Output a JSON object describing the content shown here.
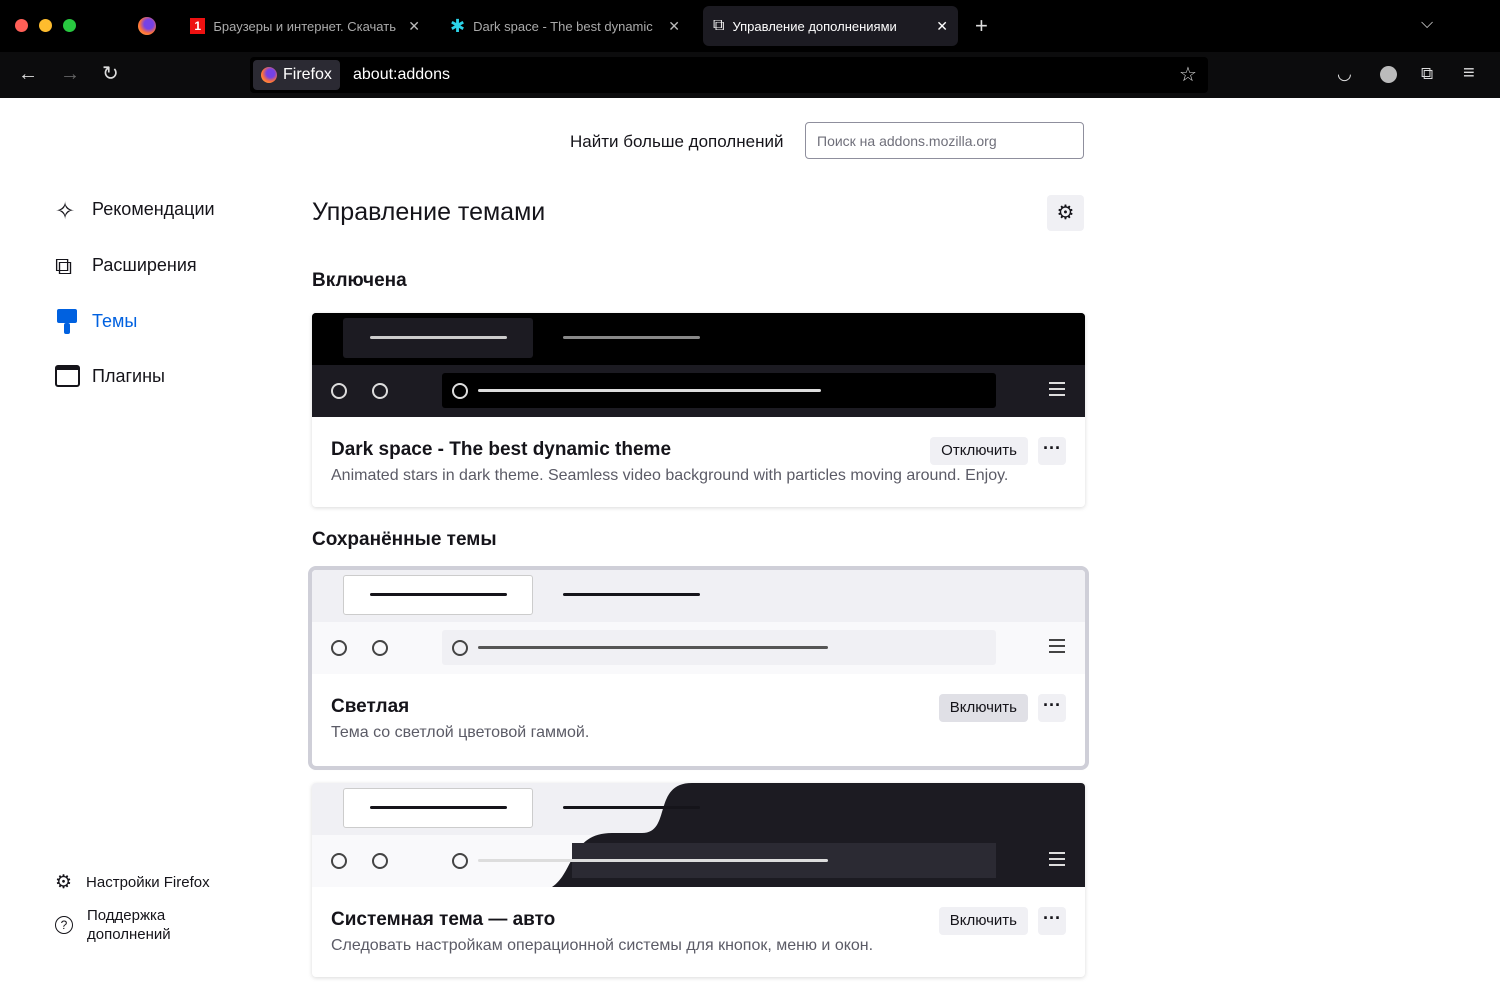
{
  "browser": {
    "tabs": [
      {
        "title": "Браузеры и интернет. Скачать",
        "icon": "softportal-icon"
      },
      {
        "title": "Dark space - The best dynamic",
        "icon": "dark-space-icon"
      },
      {
        "title": "Управление дополнениями",
        "icon": "puzzle-icon",
        "active": true
      }
    ],
    "identity": "Firefox",
    "url": "about:addons"
  },
  "header": {
    "find_more": "Найти больше дополнений",
    "search_placeholder": "Поиск на addons.mozilla.org"
  },
  "sidebar": {
    "items": [
      {
        "label": "Рекомендации",
        "icon": "sparkle-icon"
      },
      {
        "label": "Расширения",
        "icon": "puzzle-icon"
      },
      {
        "label": "Темы",
        "icon": "brush-icon",
        "selected": true
      },
      {
        "label": "Плагины",
        "icon": "plugin-icon"
      }
    ],
    "footer": [
      {
        "label": "Настройки Firefox",
        "icon": "gear-icon"
      },
      {
        "label": "Поддержка дополнений",
        "icon": "help-icon"
      }
    ]
  },
  "main": {
    "title": "Управление темами",
    "enabled_heading": "Включена",
    "saved_heading": "Сохранённые темы",
    "themes": [
      {
        "name": "Dark space - The best dynamic theme",
        "description": "Animated stars in dark theme. Seamless video background with particles moving around. Enjoy.",
        "action": "Отключить",
        "more": "···"
      },
      {
        "name": "Светлая",
        "description": "Тема со светлой цветовой гаммой.",
        "action": "Включить",
        "more": "···"
      },
      {
        "name": "Системная тема — авто",
        "description": "Следовать настройкам операционной системы для кнопок, меню и окон.",
        "action": "Включить",
        "more": "···"
      }
    ]
  },
  "colors": {
    "accent": "#0061e0",
    "chrome": "#000000"
  }
}
